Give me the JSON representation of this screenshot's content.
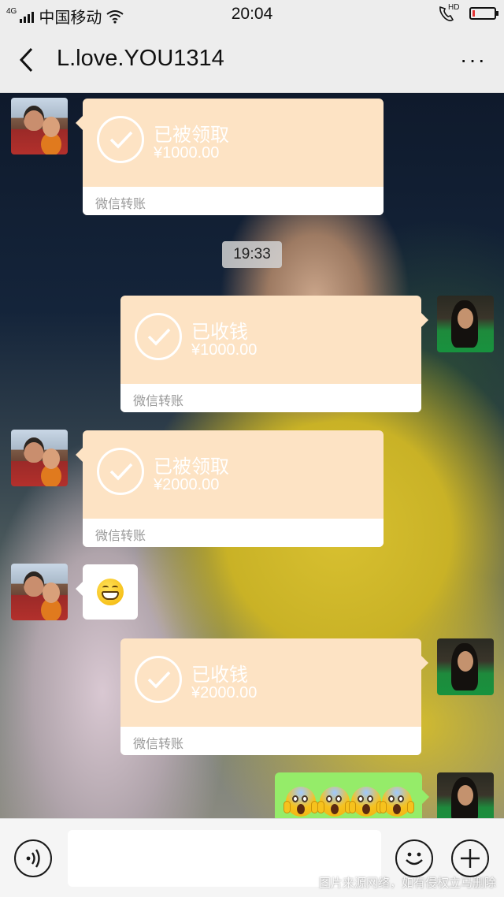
{
  "status_bar": {
    "network_type": "4G",
    "carrier": "中国移动",
    "time": "20:04",
    "call_indicator": "HD",
    "icons": [
      "signal-icon",
      "wifi-icon",
      "hd-call-icon",
      "battery-icon"
    ],
    "battery_level_fraction": 0.1,
    "battery_color": "#e33333"
  },
  "header": {
    "title": "L.love.YOU1314",
    "back_icon": "chevron-left-icon",
    "more_icon": "more-dots-icon",
    "more_label": "···"
  },
  "messages": [
    {
      "side": "left",
      "type": "transfer",
      "status": "已被领取",
      "amount": "¥1000.00",
      "footer": "微信转账"
    },
    {
      "type": "timestamp",
      "text": "19:33"
    },
    {
      "side": "right",
      "type": "transfer",
      "status": "已收钱",
      "amount": "¥1000.00",
      "footer": "微信转账"
    },
    {
      "side": "left",
      "type": "transfer",
      "status": "已被领取",
      "amount": "¥2000.00",
      "footer": "微信转账"
    },
    {
      "side": "left",
      "type": "emoji",
      "emoji": "grin-emoji"
    },
    {
      "side": "right",
      "type": "transfer",
      "status": "已收钱",
      "amount": "¥2000.00",
      "footer": "微信转账"
    },
    {
      "side": "right",
      "type": "emoji",
      "emoji": "scream-emoji",
      "count": 4
    }
  ],
  "input_bar": {
    "voice_icon": "voice-icon",
    "emoji_icon": "smiley-icon",
    "plus_icon": "plus-icon",
    "input_value": "",
    "watermark": "图片来源网络，如有侵权立马删除"
  },
  "colors": {
    "transfer_bubble": "#fde3c4",
    "sent_bubble": "#95ec69",
    "received_bubble": "#ffffff"
  }
}
